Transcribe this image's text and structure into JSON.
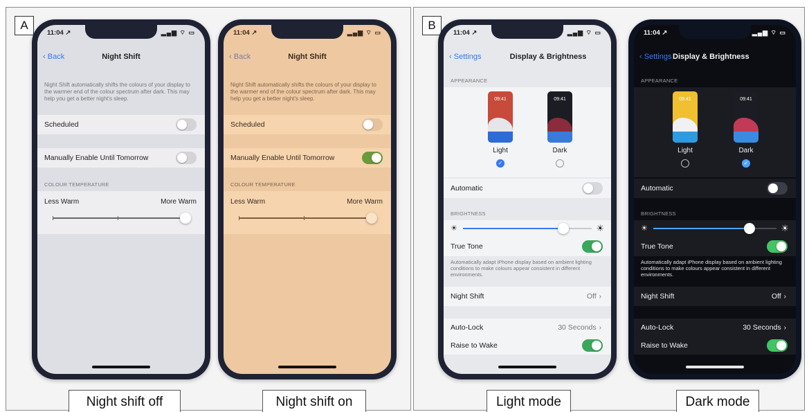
{
  "panel_a": {
    "letter": "A",
    "captions": [
      "Night shift off",
      "Night shift on"
    ]
  },
  "panel_b": {
    "letter": "B",
    "captions": [
      "Light mode",
      "Dark mode"
    ]
  },
  "status": {
    "time": "11:04",
    "location_glyph": "↗",
    "icons": "▂▄▆ ⌔ ▭"
  },
  "night_shift": {
    "back": "Back",
    "title": "Night Shift",
    "description": "Night Shift automatically shifts the colours of your display to the warmer end of the colour spectrum after dark. This may help you get a better night's sleep.",
    "scheduled": "Scheduled",
    "manual": "Manually Enable Until Tomorrow",
    "temp_header": "COLOUR TEMPERATURE",
    "less_warm": "Less Warm",
    "more_warm": "More Warm",
    "temperature_level": 1.0,
    "phone_off": {
      "scheduled_on": false,
      "manual_on": false
    },
    "phone_on": {
      "scheduled_on": false,
      "manual_on": true
    }
  },
  "display": {
    "back": "Settings",
    "title": "Display & Brightness",
    "appearance_header": "APPEARANCE",
    "thumb_time": "09:41",
    "light_label": "Light",
    "dark_label": "Dark",
    "automatic": "Automatic",
    "brightness_header": "BRIGHTNESS",
    "true_tone": "True Tone",
    "true_tone_desc": "Automatically adapt iPhone display based on ambient lighting conditions to make colours appear consistent in different environments.",
    "night_shift": "Night Shift",
    "night_shift_value": "Off",
    "auto_lock": "Auto-Lock",
    "auto_lock_value": "30 Seconds",
    "raise_to_wake": "Raise to Wake",
    "brightness_level": 0.78,
    "light_phone": {
      "selected": "light",
      "automatic_on": false,
      "true_tone_on": true,
      "raise_on": true
    },
    "dark_phone": {
      "selected": "dark",
      "automatic_on": false,
      "true_tone_on": true,
      "raise_on": true
    }
  },
  "colors": {
    "ios_blue": "#3478f6",
    "ios_green": "#3aa75a",
    "warm_tint": "#eec8a0"
  }
}
